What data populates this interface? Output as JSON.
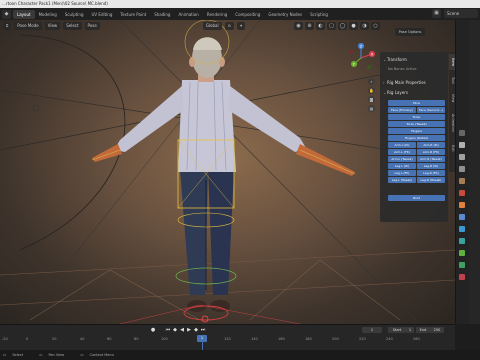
{
  "window": {
    "title": "…rtoon Character Pack1 (Men)\\02 Source\\ MC.blend)"
  },
  "workspace_tabs": [
    "Layout",
    "Modeling",
    "Sculpting",
    "UV Editing",
    "Texture Paint",
    "Shading",
    "Animation",
    "Rendering",
    "Compositing",
    "Geometry Nodes",
    "Scripting"
  ],
  "topbar": {
    "scene": "Scene"
  },
  "viewport_header": {
    "mode": "Pose Mode",
    "view": "View",
    "select": "Select",
    "pose": "Pose",
    "transform_orient": "Global",
    "pose_options": "Pose Options"
  },
  "gizmo": {
    "x": "X",
    "y": "Y",
    "z": "Z"
  },
  "npanel": {
    "transform_header": "Transform",
    "transform_sub": "No Bones Active",
    "rig_main_header": "Rig Main Properties",
    "rig_layers_header": "Rig Layers",
    "buttons": [
      [
        "Face"
      ],
      [
        "Face (Primary)",
        "Face (Second...)"
      ],
      [
        "Torso"
      ],
      [
        "Torso (Tweak)"
      ],
      [
        "Fingers"
      ],
      [
        "Fingers (Detail)"
      ],
      [
        "Arm.L (IK)",
        "Arm.R (IK)"
      ],
      [
        "Arm.L (FK)",
        "Arm.R (FK)"
      ],
      [
        "Arm.L (Tweak)",
        "Arm.R (Tweak)"
      ],
      [
        "Leg.L (IK)",
        "Leg.R (IK)"
      ],
      [
        "Leg.L (FK)",
        "Leg.R (FK)"
      ],
      [
        "Leg.L (Tweak)",
        "Leg.R (Tweak)"
      ],
      [
        "Root"
      ]
    ],
    "tabs": [
      "Item",
      "Tool",
      "View",
      "Animation",
      "Edit"
    ]
  },
  "timeline": {
    "current_frame": "1",
    "start_label": "Start",
    "start_value": "1",
    "end_label": "End",
    "end_value": "250",
    "frame_field": "Playback",
    "ticks": [
      "-20",
      "0",
      "20",
      "40",
      "60",
      "80",
      "100",
      "120",
      "140",
      "160",
      "180",
      "200",
      "220",
      "240",
      "260"
    ]
  },
  "statusbar": {
    "items": [
      "Select",
      "Pan View",
      "Context Menu"
    ]
  },
  "colors": {
    "accent": "#4772b3",
    "selected_bone": "#ffb01f",
    "panel_bg": "#2b2b2b"
  }
}
